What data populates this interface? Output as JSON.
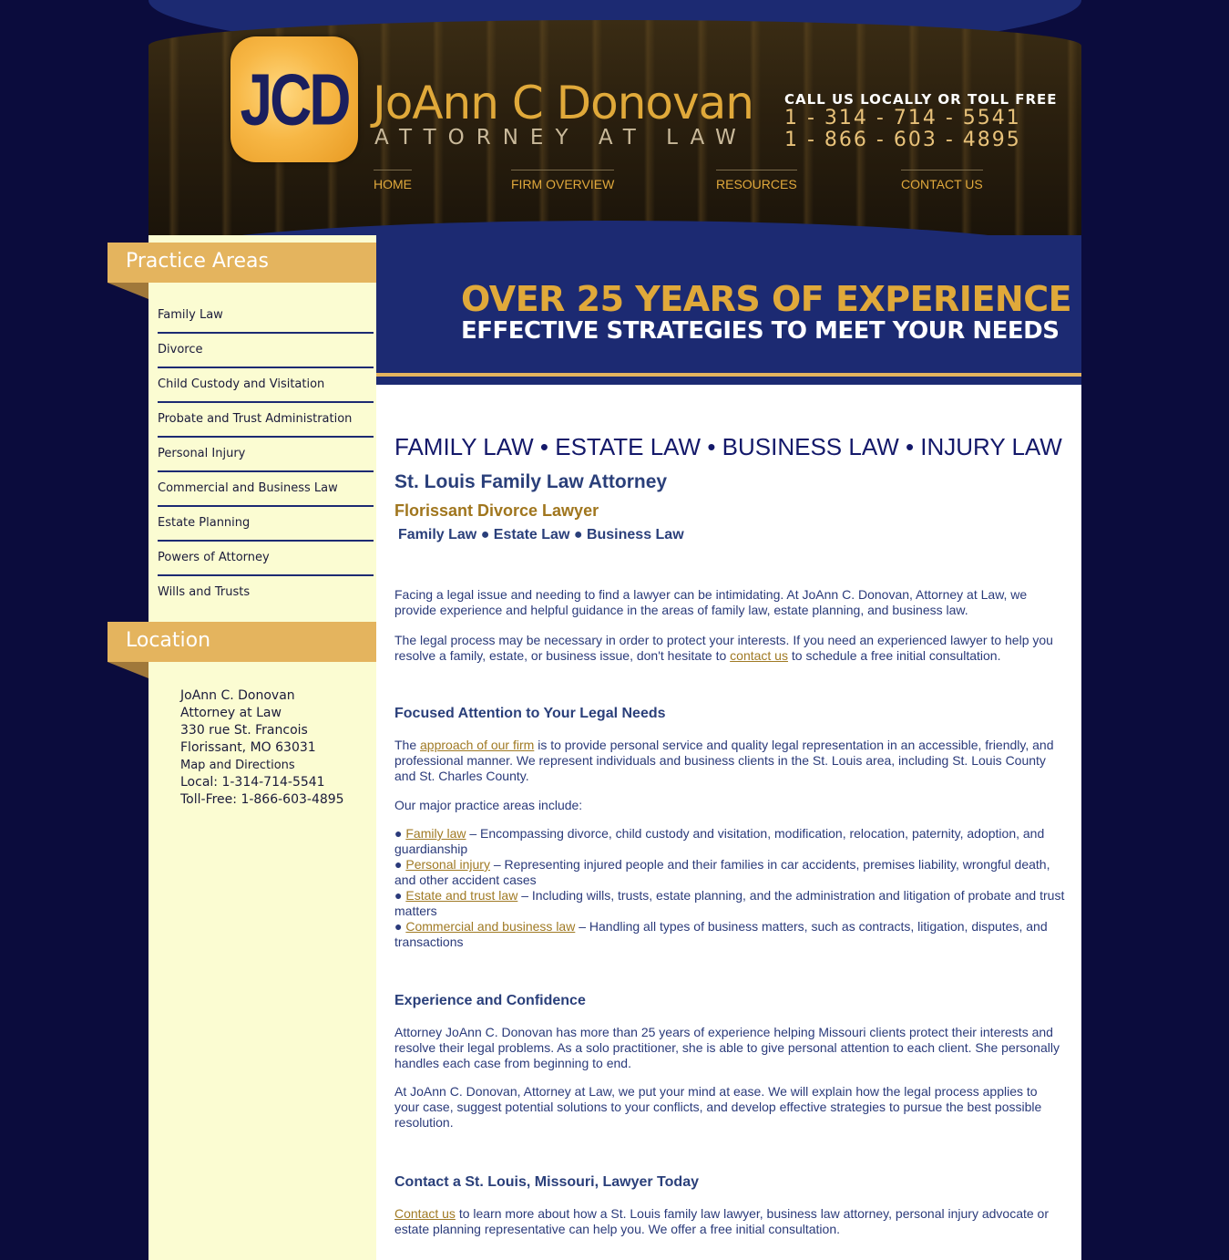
{
  "header": {
    "logo_text": "JCD",
    "firm_name": "JoAnn C Donovan",
    "firm_title": "ATTORNEY AT LAW",
    "call_label": "CALL US LOCALLY OR TOLL FREE",
    "phone_local": "1 - 314 - 714 - 5541",
    "phone_toll_free": "1 - 866 - 603 - 4895",
    "nav": [
      "HOME",
      "FIRM OVERVIEW",
      "RESOURCES",
      "CONTACT US"
    ]
  },
  "sidebar": {
    "practice_heading": "Practice Areas",
    "practice_items": [
      "Family Law",
      "Divorce",
      "Child Custody and Visitation",
      "Probate and Trust Administration",
      "Personal Injury",
      "Commercial and Business Law",
      "Estate Planning",
      "Powers of Attorney",
      "Wills and Trusts"
    ],
    "location_heading": "Location",
    "location": {
      "name": "JoAnn C. Donovan",
      "title": "Attorney at Law",
      "street": "330 rue St. Francois",
      "city": "Florissant, MO 63031",
      "map_link": "Map and Directions",
      "local": "Local: 1-314-714-5541",
      "toll_free": "Toll-Free: 1-866-603-4895"
    }
  },
  "banner": {
    "line1": "OVER 25 YEARS OF EXPERIENCE",
    "line2": "EFFECTIVE STRATEGIES TO MEET YOUR NEEDS"
  },
  "main": {
    "areas_heading": "FAMILY LAW • ESTATE LAW • BUSINESS LAW • INJURY LAW",
    "attorney_heading": "St. Louis Family Law Attorney",
    "divorce_heading": "Florissant Divorce Lawyer",
    "sub_heading": "Family Law ● Estate Law ● Business Law",
    "p1": "Facing a legal issue and needing to find a lawyer can be intimidating. At JoAnn C. Donovan, Attorney at Law, we provide experience and helpful guidance in the areas of family law, estate planning, and business law.",
    "p2_before": "The legal process may be necessary in order to protect your interests. If you need an experienced lawyer to help you resolve a family, estate, or business issue, don't hesitate to ",
    "p2_link": "contact us",
    "p2_after": " to schedule a free initial consultation.",
    "focused_heading": "Focused Attention to Your Legal Needs",
    "p3_before": "The ",
    "p3_link": "approach of our firm",
    "p3_after": " is to provide personal service and quality legal representation in an accessible, friendly, and professional manner. We represent individuals and business clients in the St. Louis area, including St. Louis County and St. Charles County.",
    "p4": "Our major practice areas include:",
    "bullets": [
      {
        "bullet": "● ",
        "link": "Family law",
        "text": " – Encompassing divorce, child custody and visitation, modification, relocation, paternity, adoption, and guardianship"
      },
      {
        "bullet": "● ",
        "link": "Personal injury",
        "text": " – Representing injured people and their families in car accidents, premises liability, wrongful death, and other accident cases"
      },
      {
        "bullet": "● ",
        "link": "Estate and trust law",
        "text": " – Including wills, trusts, estate planning, and the administration and litigation of probate and trust matters"
      },
      {
        "bullet": "● ",
        "link": "Commercial and business law",
        "text": " – Handling all types of business matters, such as contracts, litigation, disputes, and transactions"
      }
    ],
    "experience_heading": "Experience and Confidence",
    "p5": "Attorney JoAnn C. Donovan has more than 25 years of experience helping Missouri clients protect their interests and resolve their legal problems. As a solo practitioner, she is able to give personal attention to each client. She personally handles each case from beginning to end.",
    "p6": "At JoAnn C. Donovan, Attorney at Law, we put your mind at ease. We will explain how the legal process applies to your case, suggest potential solutions to your conflicts, and develop effective strategies to pursue the best possible resolution.",
    "contact_heading": "Contact a St. Louis, Missouri, Lawyer Today",
    "p7_link": "Contact us",
    "p7_after": " to learn more about how a St. Louis family law lawyer, business law attorney, personal injury advocate or estate planning representative can help you. We offer a free initial consultation."
  }
}
